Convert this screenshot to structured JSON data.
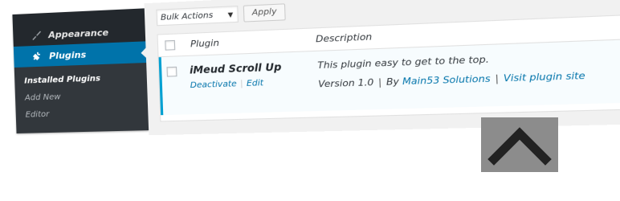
{
  "sidebar": {
    "appearance": {
      "label": "Appearance",
      "icon": "brush-icon"
    },
    "plugins": {
      "label": "Plugins",
      "icon": "plug-icon"
    },
    "submenu": [
      "Installed Plugins",
      "Add New",
      "Editor"
    ]
  },
  "toolbar": {
    "bulk_actions": "Bulk Actions",
    "apply": "Apply"
  },
  "table": {
    "headers": {
      "plugin": "Plugin",
      "description": "Description"
    },
    "rows": [
      {
        "name": "iMeud Scroll Up",
        "actions": {
          "deactivate": "Deactivate",
          "edit": "Edit"
        },
        "description": "This plugin easy to get to the top.",
        "version": "Version 1.0",
        "by": "By",
        "author": "Main53 Solutions",
        "site_link": "Visit plugin site"
      }
    ]
  },
  "scroll_up": {
    "icon": "chevron-up-icon",
    "background": "#8c8c8c",
    "color": "#222222"
  },
  "colors": {
    "sidebar": "#23282d",
    "accent": "#0073aa",
    "active_row_border": "#00a0d2"
  }
}
